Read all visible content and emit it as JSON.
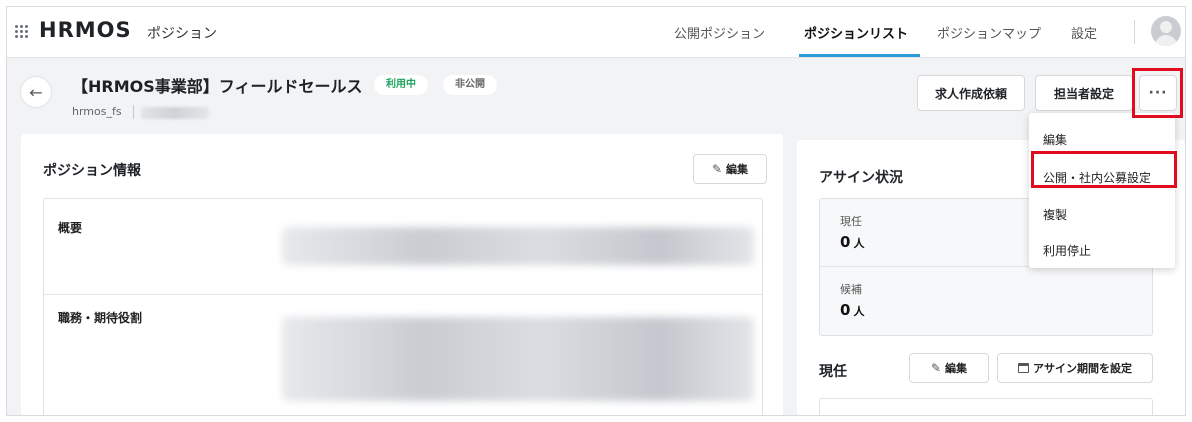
{
  "header": {
    "brand": "HRMOS",
    "brand_sub": "ポジション",
    "nav": [
      {
        "label": "公開ポジション"
      },
      {
        "label": "ポジションリスト"
      },
      {
        "label": "ポジションマップ"
      },
      {
        "label": "設定"
      }
    ],
    "active_nav": "ポジションリスト"
  },
  "position": {
    "title": "【HRMOS事業部】フィールドセールス",
    "status_badge": "利用中",
    "visibility_badge": "非公開",
    "code": "hrmos_fs"
  },
  "actions": {
    "request_label": "求人作成依頼",
    "owner_label": "担当者設定",
    "more_label": "···"
  },
  "menu": {
    "items": [
      {
        "label": "編集"
      },
      {
        "label": "公開・社内公募設定"
      },
      {
        "label": "複製"
      },
      {
        "label": "利用停止"
      }
    ],
    "highlighted": "公開・社内公募設定"
  },
  "info": {
    "title": "ポジション情報",
    "edit_label": "編集",
    "rows": [
      {
        "label": "概要"
      },
      {
        "label": "職務・期待役割"
      }
    ]
  },
  "assign": {
    "title": "アサイン状況",
    "current_label": "現任",
    "current_count": "0",
    "candidate_label": "候補",
    "candidate_count": "0",
    "unit": "人"
  },
  "current": {
    "title": "現任",
    "edit_label": "編集",
    "period_label": "アサイン期間を設定"
  },
  "colors": {
    "accent": "#2a9bd6",
    "status_green": "#19a35b",
    "highlight_red": "#e10c1e"
  }
}
